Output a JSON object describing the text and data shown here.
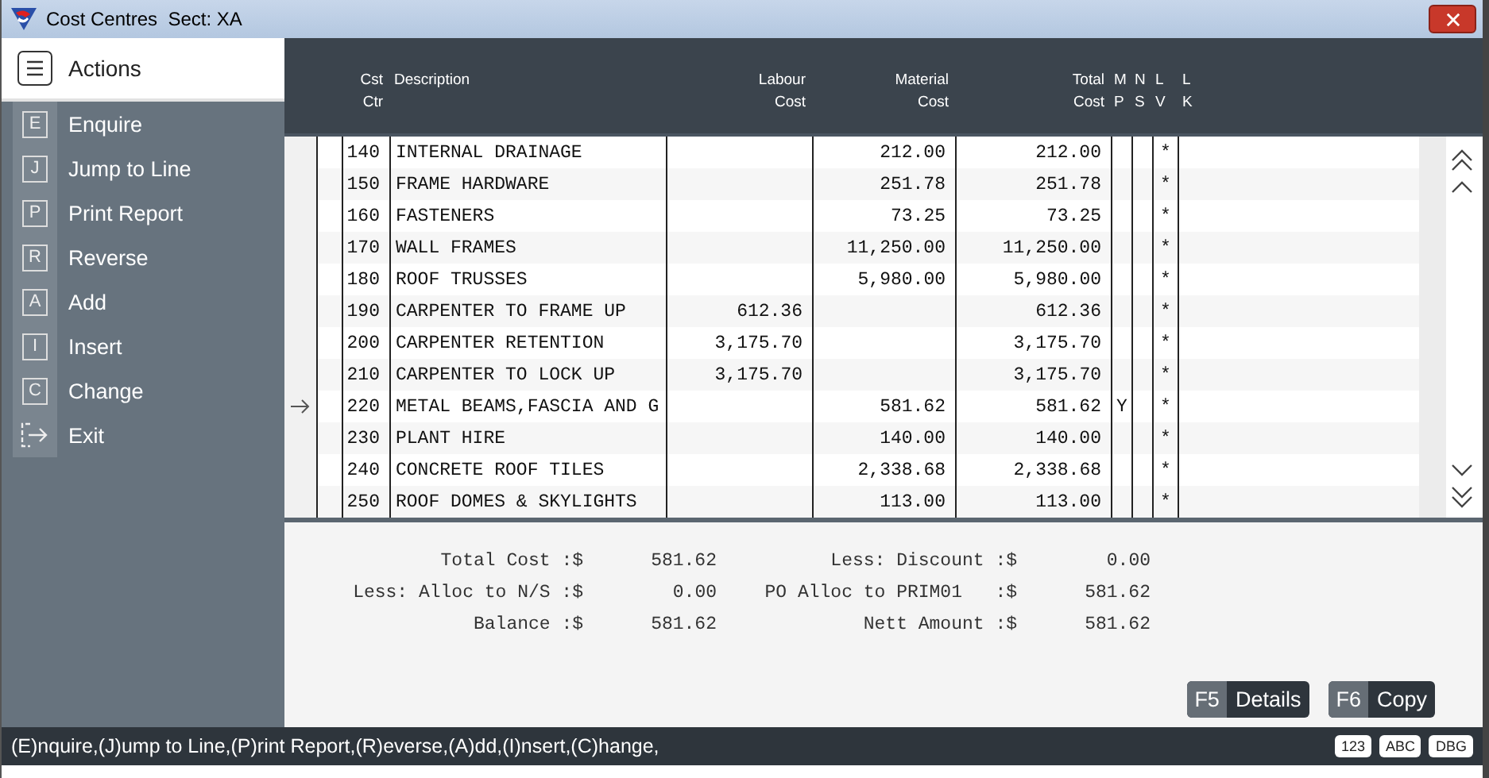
{
  "window": {
    "title": "Cost Centres  Sect: XA"
  },
  "sidebar": {
    "title": "Actions",
    "items": [
      {
        "kind": "key",
        "key": "E",
        "label": "Enquire"
      },
      {
        "kind": "key",
        "key": "J",
        "label": "Jump to Line"
      },
      {
        "kind": "key",
        "key": "P",
        "label": "Print Report"
      },
      {
        "kind": "key",
        "key": "R",
        "label": "Reverse"
      },
      {
        "kind": "key",
        "key": "A",
        "label": "Add"
      },
      {
        "kind": "key",
        "key": "I",
        "label": "Insert"
      },
      {
        "kind": "key",
        "key": "C",
        "label": "Change"
      },
      {
        "kind": "exit",
        "label": "Exit"
      }
    ]
  },
  "table": {
    "columns": [
      [
        "Cst",
        "Ctr"
      ],
      [
        "Description"
      ],
      [
        "Labour",
        "Cost"
      ],
      [
        "Material",
        "Cost"
      ],
      [
        "Total",
        "Cost"
      ],
      [
        "M",
        "P"
      ],
      [
        "N",
        "S"
      ],
      [
        "L",
        "V"
      ],
      [
        "L",
        "K"
      ]
    ],
    "rows": [
      {
        "current": false,
        "code": "140",
        "description": "INTERNAL DRAINAGE",
        "labour": "",
        "material": "212.00",
        "total": "212.00",
        "mp": "",
        "lv": "*"
      },
      {
        "current": false,
        "code": "150",
        "description": "FRAME HARDWARE",
        "labour": "",
        "material": "251.78",
        "total": "251.78",
        "mp": "",
        "lv": "*"
      },
      {
        "current": false,
        "code": "160",
        "description": "FASTENERS",
        "labour": "",
        "material": "73.25",
        "total": "73.25",
        "mp": "",
        "lv": "*"
      },
      {
        "current": false,
        "code": "170",
        "description": "WALL FRAMES",
        "labour": "",
        "material": "11,250.00",
        "total": "11,250.00",
        "mp": "",
        "lv": "*"
      },
      {
        "current": false,
        "code": "180",
        "description": "ROOF TRUSSES",
        "labour": "",
        "material": "5,980.00",
        "total": "5,980.00",
        "mp": "",
        "lv": "*"
      },
      {
        "current": false,
        "code": "190",
        "description": "CARPENTER TO FRAME UP",
        "labour": "612.36",
        "material": "",
        "total": "612.36",
        "mp": "",
        "lv": "*"
      },
      {
        "current": false,
        "code": "200",
        "description": "CARPENTER RETENTION",
        "labour": "3,175.70",
        "material": "",
        "total": "3,175.70",
        "mp": "",
        "lv": "*"
      },
      {
        "current": false,
        "code": "210",
        "description": "CARPENTER TO LOCK UP",
        "labour": "3,175.70",
        "material": "",
        "total": "3,175.70",
        "mp": "",
        "lv": "*"
      },
      {
        "current": true,
        "code": "220",
        "description": "METAL BEAMS,FASCIA AND G",
        "labour": "",
        "material": "581.62",
        "total": "581.62",
        "mp": "Y",
        "lv": "*"
      },
      {
        "current": false,
        "code": "230",
        "description": "PLANT HIRE",
        "labour": "",
        "material": "140.00",
        "total": "140.00",
        "mp": "",
        "lv": "*"
      },
      {
        "current": false,
        "code": "240",
        "description": "CONCRETE ROOF TILES",
        "labour": "",
        "material": "2,338.68",
        "total": "2,338.68",
        "mp": "",
        "lv": "*"
      },
      {
        "current": false,
        "code": "250",
        "description": "ROOF DOMES & SKYLIGHTS",
        "labour": "",
        "material": "113.00",
        "total": "113.00",
        "mp": "",
        "lv": "*"
      }
    ]
  },
  "summary": [
    {
      "label": "Total Cost :$",
      "value": "581.62"
    },
    {
      "label": "Less: Discount :$",
      "value": "0.00"
    },
    {
      "label": "Less: Alloc to N/S :$",
      "value": "0.00"
    },
    {
      "label": "PO Alloc to PRIM01   :$",
      "value": "581.62"
    },
    {
      "label": "Balance :$",
      "value": "581.62"
    },
    {
      "label": "Nett Amount :$",
      "value": "581.62"
    }
  ],
  "buttons": [
    {
      "key": "F5",
      "label": "Details"
    },
    {
      "key": "F6",
      "label": "Copy"
    }
  ],
  "status_bar": {
    "text": "(E)nquire,(J)ump to Line,(P)rint Report,(R)everse,(A)dd,(I)nsert,(C)hange,",
    "indicators": [
      "123",
      "ABC",
      "DBG"
    ]
  }
}
